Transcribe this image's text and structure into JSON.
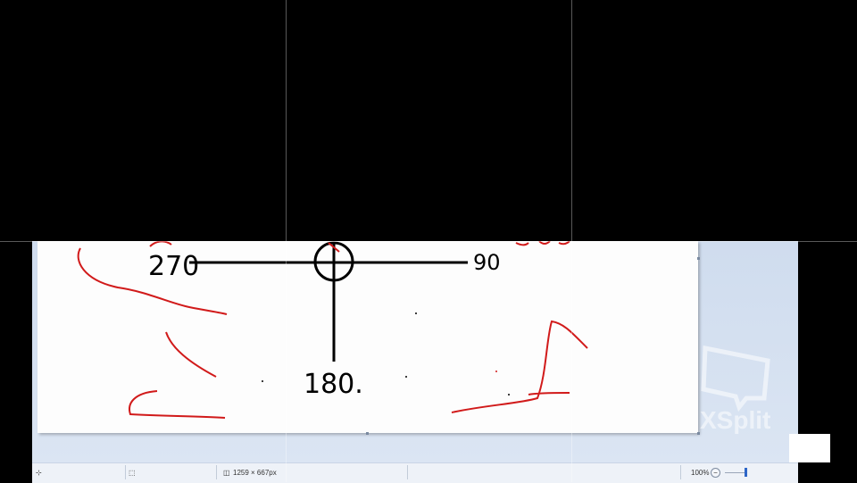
{
  "canvas": {
    "drawing_labels": [
      "270",
      "90",
      "180."
    ]
  },
  "status": {
    "position_icon": "crosshair-icon",
    "selection_icon": "selection-icon",
    "canvas_size_icon": "canvas-size-icon",
    "canvas_size": "1259 × 667px",
    "zoom_level": "100%",
    "zoom_out_symbol": "−"
  },
  "watermark": {
    "text": "XSplit"
  },
  "colors": {
    "ink_black": "#000000",
    "ink_red": "#d11a1a",
    "canvas_bg": "#fdfdfd",
    "workspace_bg": "#d6e1f0"
  }
}
